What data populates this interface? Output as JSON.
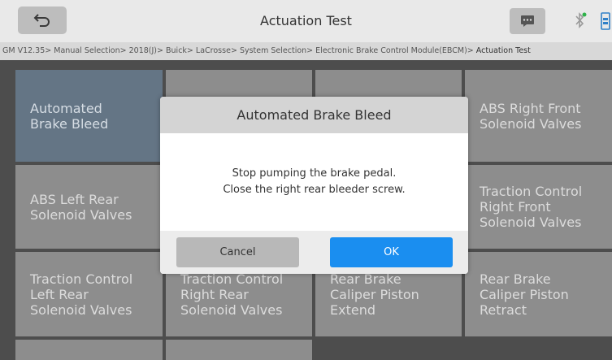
{
  "header": {
    "title": "Actuation Test",
    "back_icon": "back-arrow-icon",
    "message_icon": "chat-icon",
    "bluetooth_icon": "bluetooth-icon",
    "battery_icon": "battery-icon"
  },
  "breadcrumb": {
    "items": [
      "GM V12.35",
      "Manual Selection",
      "2018(J)",
      "Buick",
      "LaCrosse",
      "System Selection",
      "Electronic Brake Control Module(EBCM)",
      "Actuation Test"
    ],
    "separator": ">"
  },
  "grid": {
    "tiles": [
      {
        "line1": "Automated",
        "line2": "Brake Bleed",
        "line3": ""
      },
      {
        "line1": "",
        "line2": "",
        "line3": ""
      },
      {
        "line1": "",
        "line2": "",
        "line3": ""
      },
      {
        "line1": "ABS Right Front",
        "line2": "Solenoid Valves",
        "line3": ""
      },
      {
        "line1": "ABS Left Rear",
        "line2": "Solenoid Valves",
        "line3": ""
      },
      {
        "line1": "",
        "line2": "",
        "line3": ""
      },
      {
        "line1": "",
        "line2": "",
        "line3": ""
      },
      {
        "line1": "Traction Control",
        "line2": "Right Front",
        "line3": "Solenoid Valves"
      },
      {
        "line1": "Traction Control",
        "line2": "Left Rear",
        "line3": "Solenoid Valves"
      },
      {
        "line1": "Traction Control",
        "line2": "Right Rear",
        "line3": "Solenoid Valves"
      },
      {
        "line1": "Rear Brake",
        "line2": "Caliper Piston",
        "line3": "Extend"
      },
      {
        "line1": "Rear Brake",
        "line2": "Caliper Piston",
        "line3": "Retract"
      }
    ]
  },
  "dialog": {
    "title": "Automated Brake Bleed",
    "message_line1": "Stop pumping the brake pedal.",
    "message_line2": "Close the right rear bleeder screw.",
    "cancel_label": "Cancel",
    "ok_label": "OK"
  },
  "colors": {
    "accent": "#1a8ef0",
    "selected_tile": "#647585",
    "tile": "#8d8d8d"
  }
}
